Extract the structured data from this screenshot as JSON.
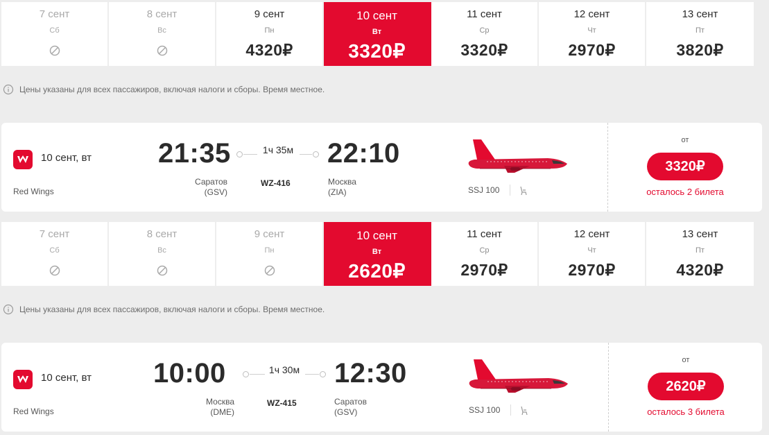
{
  "brand_color": "#e30a2f",
  "strip1": {
    "days": [
      {
        "date": "7 сент",
        "weekday": "Сб",
        "price": null
      },
      {
        "date": "8 сент",
        "weekday": "Вс",
        "price": null
      },
      {
        "date": "9 сент",
        "weekday": "Пн",
        "price": "4320₽"
      },
      {
        "date": "10 сент",
        "weekday": "Вт",
        "price": "3320₽"
      },
      {
        "date": "11 сент",
        "weekday": "Ср",
        "price": "3320₽"
      },
      {
        "date": "12 сент",
        "weekday": "Чт",
        "price": "2970₽"
      },
      {
        "date": "13 сент",
        "weekday": "Пт",
        "price": "3820₽"
      }
    ],
    "selected_index": 3
  },
  "info_text": "Цены указаны для всех пассажиров, включая налоги и сборы. Время местное.",
  "flight1": {
    "date": "10 сент, вт",
    "airline": "Red Wings",
    "dep_time": "21:35",
    "arr_time": "22:10",
    "duration": "1ч 35м",
    "dep_city": "Саратов",
    "dep_code": "(GSV)",
    "arr_city": "Москва",
    "arr_code": "(ZIA)",
    "flight_no": "WZ-416",
    "aircraft": "SSJ 100",
    "from_label": "от",
    "price": "3320₽",
    "seats_left": "осталось 2 билета"
  },
  "strip2": {
    "days": [
      {
        "date": "7 сент",
        "weekday": "Сб",
        "price": null
      },
      {
        "date": "8 сент",
        "weekday": "Вс",
        "price": null
      },
      {
        "date": "9 сент",
        "weekday": "Пн",
        "price": null
      },
      {
        "date": "10 сент",
        "weekday": "Вт",
        "price": "2620₽"
      },
      {
        "date": "11 сент",
        "weekday": "Ср",
        "price": "2970₽"
      },
      {
        "date": "12 сент",
        "weekday": "Чт",
        "price": "2970₽"
      },
      {
        "date": "13 сент",
        "weekday": "Пт",
        "price": "4320₽"
      }
    ],
    "selected_index": 3
  },
  "flight2": {
    "date": "10 сент, вт",
    "airline": "Red Wings",
    "dep_time": "10:00",
    "arr_time": "12:30",
    "duration": "1ч 30м",
    "dep_city": "Москва",
    "dep_code": "(DME)",
    "arr_city": "Саратов",
    "arr_code": "(GSV)",
    "flight_no": "WZ-415",
    "aircraft": "SSJ 100",
    "from_label": "от",
    "price": "2620₽",
    "seats_left": "осталось 3 билета"
  }
}
